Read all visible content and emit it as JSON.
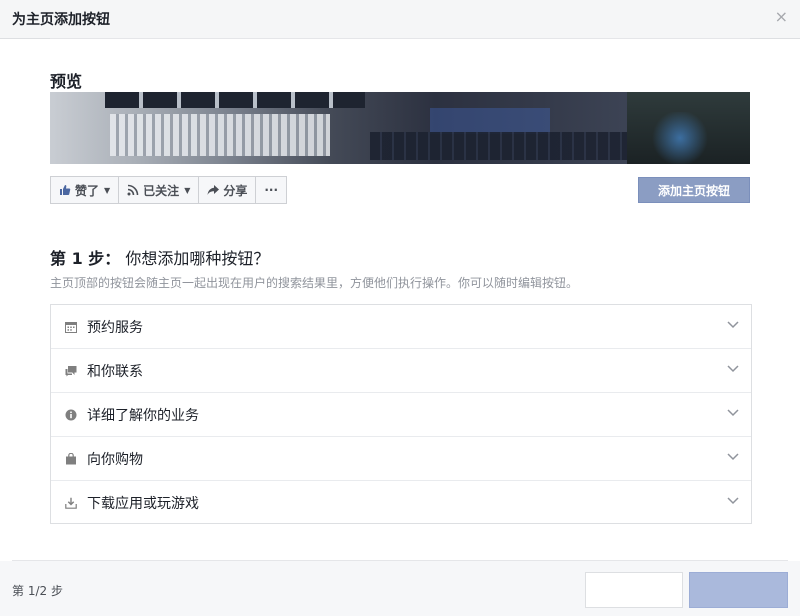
{
  "dialog": {
    "title": "为主页添加按钮",
    "close": "×"
  },
  "preview": {
    "label": "预览"
  },
  "actions": {
    "like": "赞了",
    "follow": "已关注",
    "share": "分享",
    "more": "···",
    "add_button": "添加主页按钮"
  },
  "step": {
    "prefix": "第 1 步：",
    "question": "你想添加哪种按钮？",
    "description": "主页顶部的按钮会随主页一起出现在用户的搜索结果里，方便他们执行操作。你可以随时编辑按钮。"
  },
  "options": [
    {
      "label": "预约服务",
      "icon": "calendar-icon"
    },
    {
      "label": "和你联系",
      "icon": "chat-bubbles-icon"
    },
    {
      "label": "详细了解你的业务",
      "icon": "info-icon"
    },
    {
      "label": "向你购物",
      "icon": "shopping-bag-icon"
    },
    {
      "label": "下载应用或玩游戏",
      "icon": "download-icon"
    }
  ],
  "footer": {
    "step_count": "第 1/2 步"
  },
  "colors": {
    "primary_button": "#8b9dc3",
    "next_button": "#aab9dc",
    "muted_text": "#90949c"
  }
}
